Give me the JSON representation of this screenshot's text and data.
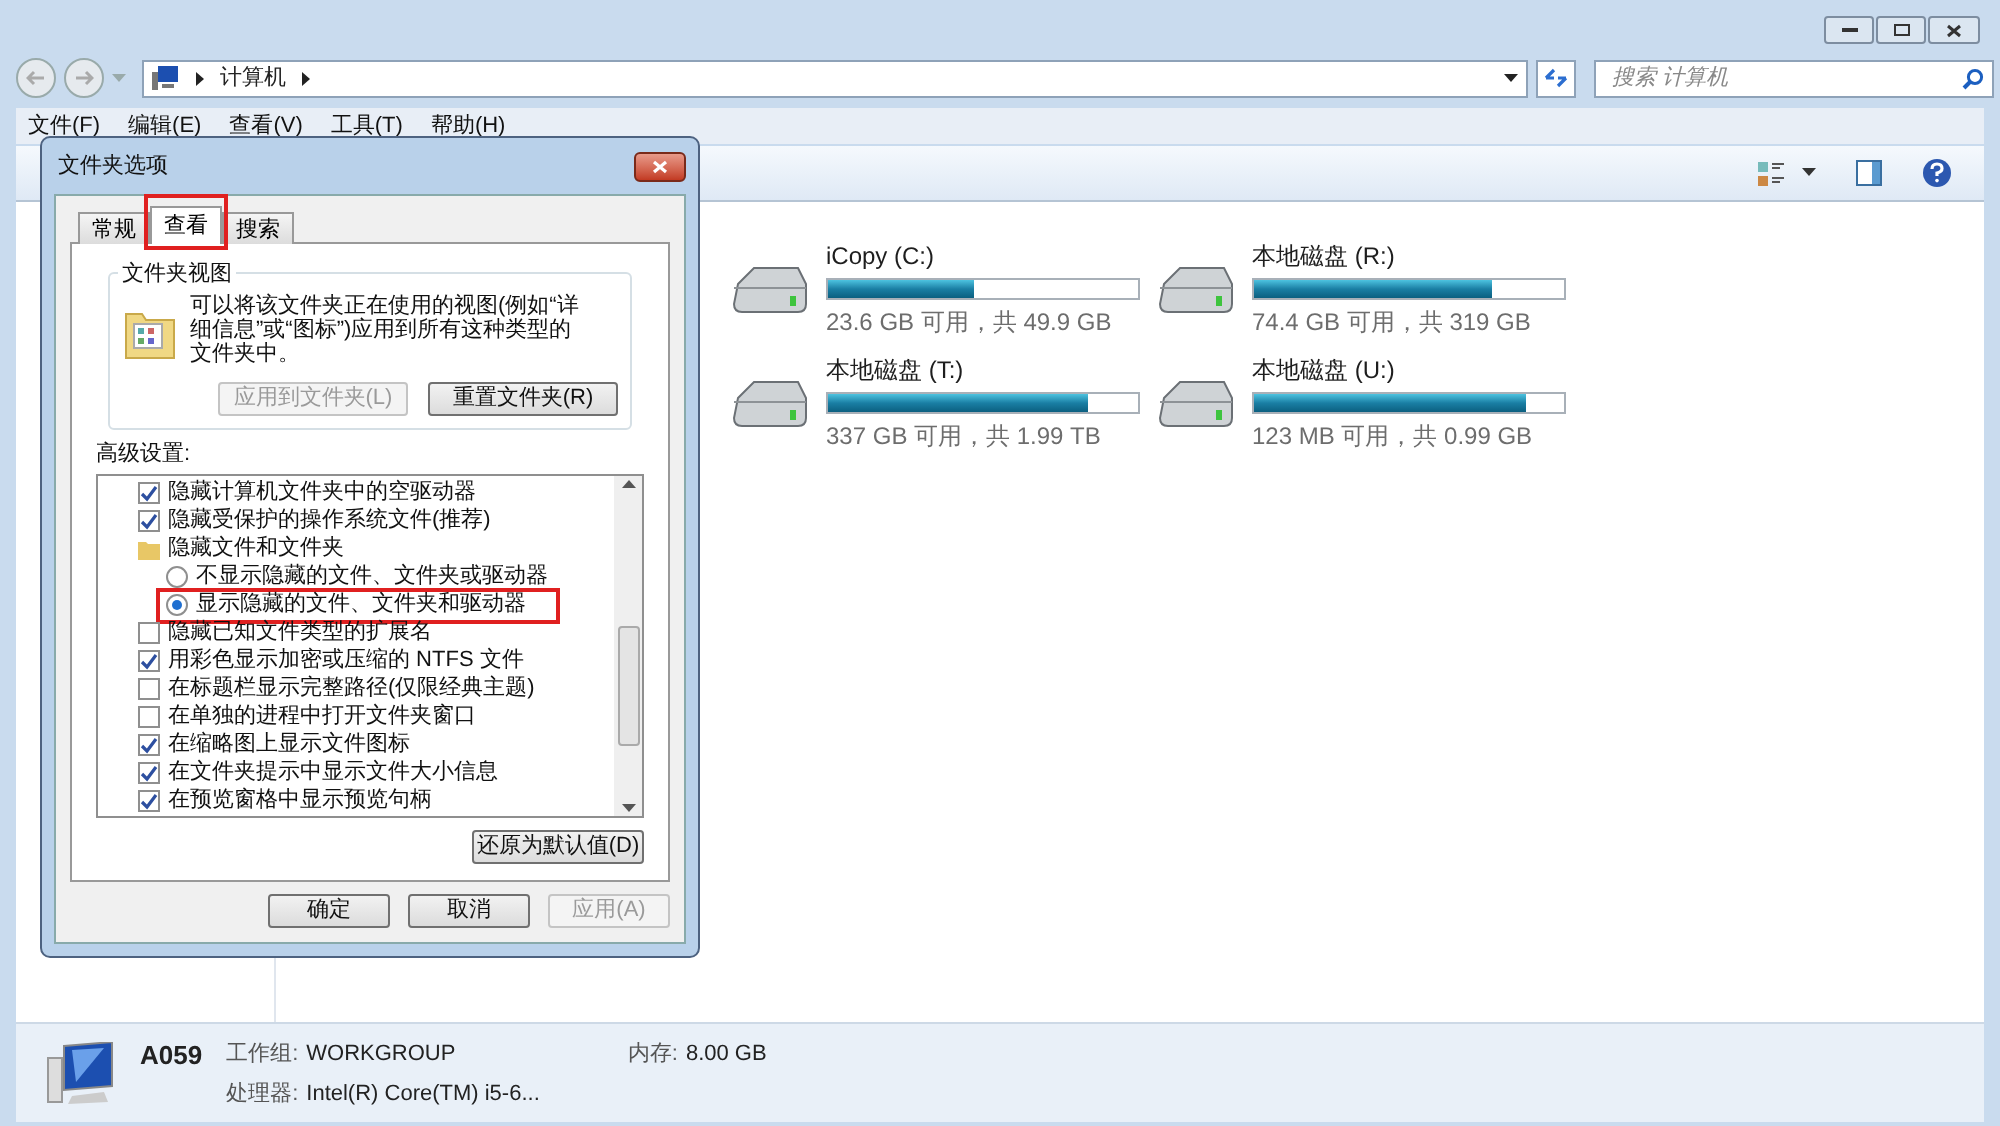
{
  "explorer": {
    "address": {
      "crumbs": [
        "计算机"
      ]
    },
    "search": {
      "placeholder": "搜索 计算机"
    },
    "menu": [
      "文件(F)",
      "编辑(E)",
      "查看(V)",
      "工具(T)",
      "帮助(H)"
    ],
    "drives": [
      {
        "name": "iCopy (C:)",
        "level": 0.47,
        "reading": "23.6 GB 可用，共 49.9 GB"
      },
      {
        "name": "本地磁盘 (R:)",
        "level": 0.77,
        "reading": "74.4 GB 可用，共 319 GB"
      },
      {
        "name": "本地磁盘 (T:)",
        "level": 0.84,
        "reading": "337 GB 可用，共 1.99 TB"
      },
      {
        "name": "本地磁盘 (U:)",
        "level": 0.88,
        "reading": "123 MB 可用，共 0.99 GB"
      }
    ],
    "details": {
      "computer": "A059",
      "fields": [
        {
          "label": "工作组:",
          "value": "WORKGROUP"
        },
        {
          "label": "内存:",
          "value": "8.00 GB"
        },
        {
          "label": "处理器:",
          "value": "Intel(R) Core(TM) i5-6..."
        }
      ]
    }
  },
  "dialog": {
    "title": "文件夹选项",
    "tabs": [
      {
        "label": "常规",
        "selected": false
      },
      {
        "label": "查看",
        "selected": true
      },
      {
        "label": "搜索",
        "selected": false
      }
    ],
    "folder_views": {
      "title": "文件夹视图",
      "text": "可以将该文件夹正在使用的视图(例如“详细信息”或“图标”)应用到所有这种类型的文件夹中。",
      "buttons": [
        {
          "label": "应用到文件夹(L)",
          "disabled": true
        },
        {
          "label": "重置文件夹(R)",
          "disabled": false
        }
      ]
    },
    "advanced": {
      "title": "高级设置:",
      "items": [
        {
          "kind": "checkbox",
          "label": "隐藏计算机文件夹中的空驱动器",
          "checked": true
        },
        {
          "kind": "checkbox",
          "label": "隐藏受保护的操作系统文件(推荐)",
          "checked": true
        },
        {
          "kind": "folder",
          "label": "隐藏文件和文件夹",
          "children": [
            {
              "kind": "radio",
              "label": "不显示隐藏的文件、文件夹或驱动器",
              "selected": false
            },
            {
              "kind": "radio",
              "label": "显示隐藏的文件、文件夹和驱动器",
              "selected": true,
              "highlighted": true
            }
          ]
        },
        {
          "kind": "checkbox",
          "label": "隐藏已知文件类型的扩展名",
          "checked": false
        },
        {
          "kind": "checkbox",
          "label": "用彩色显示加密或压缩的 NTFS 文件",
          "checked": true
        },
        {
          "kind": "checkbox",
          "label": "在标题栏显示完整路径(仅限经典主题)",
          "checked": false
        },
        {
          "kind": "checkbox",
          "label": "在单独的进程中打开文件夹窗口",
          "checked": false
        },
        {
          "kind": "checkbox",
          "label": "在缩略图上显示文件图标",
          "checked": true
        },
        {
          "kind": "checkbox",
          "label": "在文件夹提示中显示文件大小信息",
          "checked": true
        },
        {
          "kind": "checkbox",
          "label": "在预览窗格中显示预览句柄",
          "checked": true
        }
      ]
    },
    "restore_button": "还原为默认值(D)",
    "buttons": [
      {
        "label": "确定",
        "disabled": false
      },
      {
        "label": "取消",
        "disabled": false
      },
      {
        "label": "应用(A)",
        "disabled": true
      }
    ]
  }
}
